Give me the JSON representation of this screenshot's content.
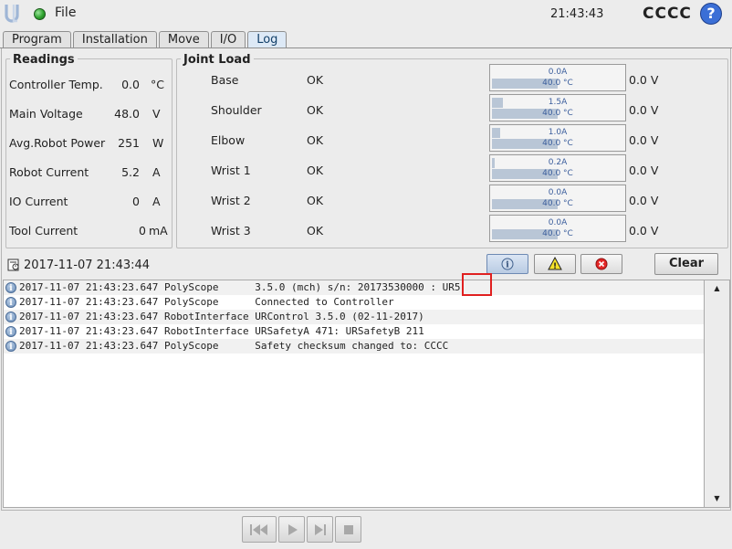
{
  "topbar": {
    "file_label": "File",
    "clock": "21:43:43",
    "robot_name": "CCCC",
    "help_label": "?"
  },
  "tabs": [
    {
      "label": "Program",
      "active": false
    },
    {
      "label": "Installation",
      "active": false
    },
    {
      "label": "Move",
      "active": false
    },
    {
      "label": "I/O",
      "active": false
    },
    {
      "label": "Log",
      "active": true
    }
  ],
  "readings": {
    "title": "Readings",
    "items": [
      {
        "label": "Controller Temp.",
        "value": "0.0",
        "unit": "°C"
      },
      {
        "label": "Main Voltage",
        "value": "48.0",
        "unit": "V"
      },
      {
        "label": "Avg.Robot Power",
        "value": "251",
        "unit": "W"
      },
      {
        "label": "Robot Current",
        "value": "5.2",
        "unit": "A"
      },
      {
        "label": "IO Current",
        "value": "0",
        "unit": "A"
      },
      {
        "label": "Tool Current",
        "value": "0",
        "unit": "mA"
      }
    ]
  },
  "joint_load": {
    "title": "Joint Load",
    "joints": [
      {
        "name": "Base",
        "status": "OK",
        "current": "0.0A",
        "current_fraction": 0.0,
        "temp": "40.0 °C",
        "temp_fraction": 0.5,
        "voltage": "0.0 V"
      },
      {
        "name": "Shoulder",
        "status": "OK",
        "current": "1.5A",
        "current_fraction": 0.08,
        "temp": "40.0 °C",
        "temp_fraction": 0.5,
        "voltage": "0.0 V"
      },
      {
        "name": "Elbow",
        "status": "OK",
        "current": "1.0A",
        "current_fraction": 0.06,
        "temp": "40.0 °C",
        "temp_fraction": 0.5,
        "voltage": "0.0 V"
      },
      {
        "name": "Wrist 1",
        "status": "OK",
        "current": "0.2A",
        "current_fraction": 0.02,
        "temp": "40.0 °C",
        "temp_fraction": 0.5,
        "voltage": "0.0 V"
      },
      {
        "name": "Wrist 2",
        "status": "OK",
        "current": "0.0A",
        "current_fraction": 0.0,
        "temp": "40.0 °C",
        "temp_fraction": 0.5,
        "voltage": "0.0 V"
      },
      {
        "name": "Wrist 3",
        "status": "OK",
        "current": "0.0A",
        "current_fraction": 0.0,
        "temp": "40.0 °C",
        "temp_fraction": 0.5,
        "voltage": "0.0 V"
      }
    ]
  },
  "log": {
    "date": "2017-11-07 21:43:44",
    "clear_label": "Clear",
    "entries": [
      {
        "timestamp": "2017-11-07 21:43:23.647",
        "source": "PolyScope",
        "message": "3.5.0 (mch) s/n: 20173530000 : UR5"
      },
      {
        "timestamp": "2017-11-07 21:43:23.647",
        "source": "PolyScope",
        "message": "Connected to Controller"
      },
      {
        "timestamp": "2017-11-07 21:43:23.647",
        "source": "RobotInterface",
        "message": "URControl 3.5.0 (02-11-2017)"
      },
      {
        "timestamp": "2017-11-07 21:43:23.647",
        "source": "RobotInterface",
        "message": "URSafetyA 471: URSafetyB 211"
      },
      {
        "timestamp": "2017-11-07 21:43:23.647",
        "source": "PolyScope",
        "message": "Safety checksum changed to: CCCC"
      }
    ]
  },
  "colors": {
    "accent": "#3b6fd6",
    "highlight": "#e02020",
    "meter_fill": "#b9c6d6"
  },
  "icons": [
    "ur-logo-icon",
    "status-dot-icon",
    "help-icon",
    "log-file-icon",
    "info-filter-icon",
    "warning-filter-icon",
    "error-filter-icon",
    "info-icon",
    "scroll-up-icon",
    "scroll-down-icon",
    "rewind-icon",
    "play-icon",
    "step-icon",
    "stop-icon"
  ]
}
